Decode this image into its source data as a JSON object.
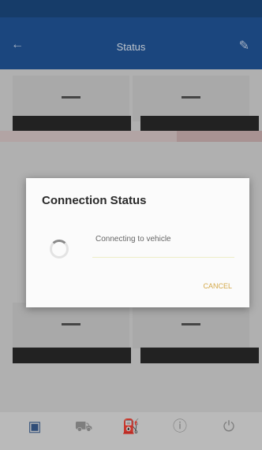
{
  "status_bar": {
    "left": "",
    "right": ""
  },
  "app_bar": {
    "title": "Status",
    "back_icon": "back-arrow-icon",
    "edit_icon": "edit-pencil-icon"
  },
  "cards": [
    {
      "button_label": ""
    },
    {
      "button_label": ""
    },
    {
      "button_label": ""
    },
    {
      "button_label": ""
    }
  ],
  "dialog": {
    "title": "Connection Status",
    "message": "Connecting to vehicle",
    "cancel_label": "CANCEL"
  },
  "bottom_nav": {
    "items": [
      {
        "icon": "vehicle-icon",
        "label": ""
      },
      {
        "icon": "car-icon",
        "label": ""
      },
      {
        "icon": "gas-pump-icon",
        "label": ""
      },
      {
        "icon": "info-icon",
        "label": ""
      },
      {
        "icon": "power-icon",
        "label": ""
      }
    ]
  },
  "colors": {
    "app_bar": "#21569a",
    "status_bar": "#1c4a80",
    "accent": "#d4a94a"
  }
}
